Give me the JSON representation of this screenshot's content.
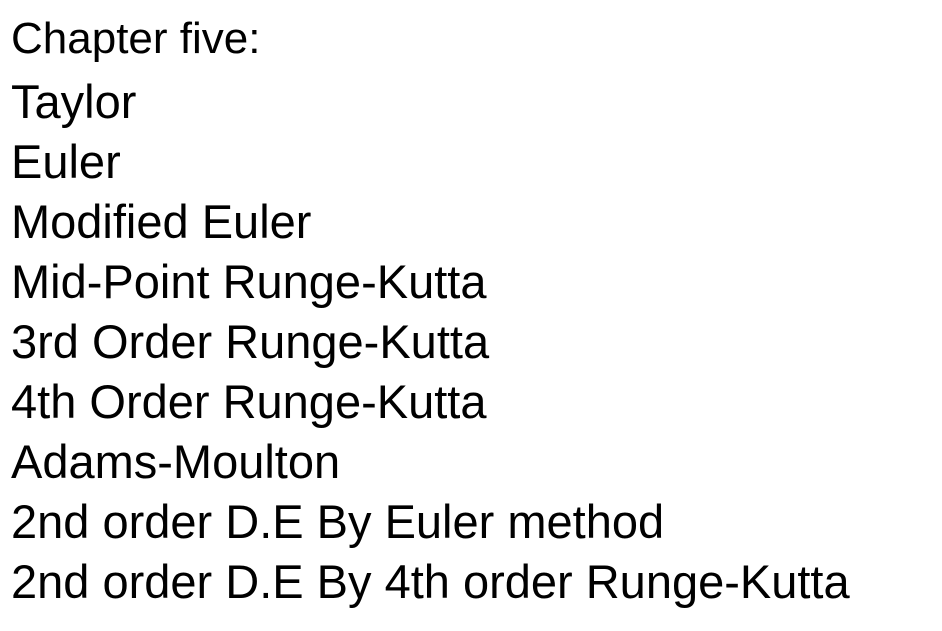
{
  "heading": "Chapter five:",
  "items": [
    "Taylor",
    "Euler",
    "Modified Euler",
    "Mid-Point Runge-Kutta",
    "3rd Order Runge-Kutta",
    "4th Order Runge-Kutta",
    "Adams-Moulton",
    "2nd order D.E By Euler method",
    "2nd order D.E By 4th order Runge-Kutta"
  ]
}
